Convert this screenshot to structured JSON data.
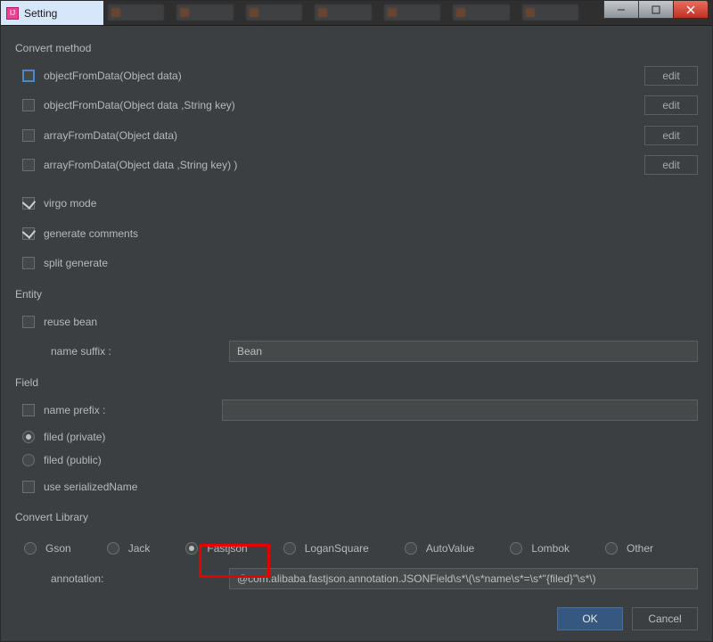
{
  "window": {
    "title": "Setting"
  },
  "sections": {
    "convert_method": "Convert method",
    "entity": "Entity",
    "field": "Field",
    "convert_library": "Convert Library"
  },
  "methods": {
    "m1": "objectFromData(Object data)",
    "m2": "objectFromData(Object data ,String key)",
    "m3": "arrayFromData(Object data)",
    "m4": "arrayFromData(Object data ,String key) )",
    "edit": "edit"
  },
  "options": {
    "virgo": "virgo mode",
    "gen_comments": "generate comments",
    "split_gen": "split generate",
    "reuse_bean": "reuse bean",
    "name_suffix_label": "name suffix :",
    "name_suffix_value": "Bean",
    "name_prefix_label": "name prefix :",
    "name_prefix_value": "",
    "field_private": "filed (private)",
    "field_public": "filed (public)",
    "use_serialized": "use serializedName"
  },
  "libs": {
    "gson": "Gson",
    "jack": "Jack",
    "fastjson": "Fastjson",
    "logansquare": "LoganSquare",
    "autovalue": "AutoValue",
    "lombok": "Lombok",
    "other": "Other",
    "annotation_label": "annotation:",
    "annotation_value": "@com.alibaba.fastjson.annotation.JSONField\\s*\\(\\s*name\\s*=\\s*\"{filed}\"\\s*\\)"
  },
  "buttons": {
    "ok": "OK",
    "cancel": "Cancel"
  }
}
